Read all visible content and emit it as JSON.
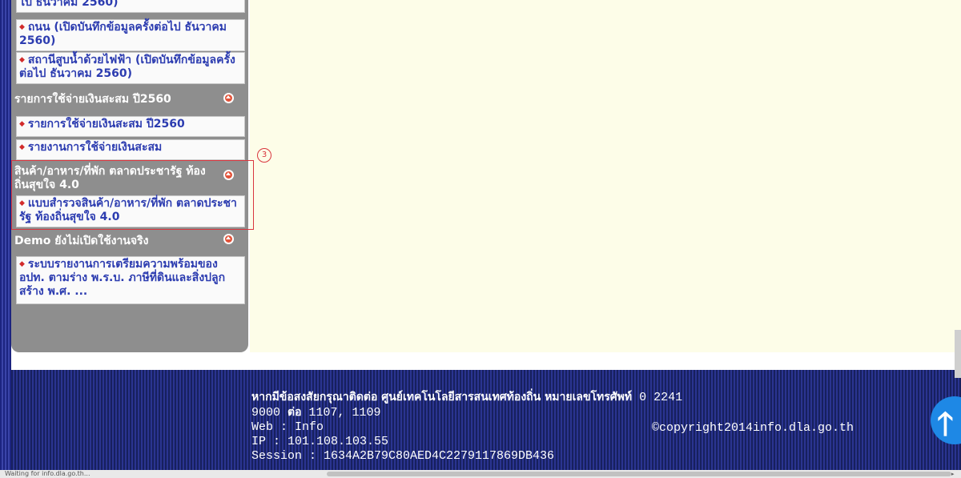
{
  "sidebar": {
    "top_cut_text": "ไป ธันวาคม 2560)",
    "links_group1": [
      "ถนน (เปิดบันทึกข้อมูลครั้งต่อไป ธันวาคม 2560)",
      "สถานีสูบน้ำด้วยไฟฟ้า (เปิดบันทึกข้อมูลครั้งต่อไป ธันวาคม 2560)"
    ],
    "section2": {
      "header": "รายการใช้จ่ายเงินสะสม ปี2560",
      "links": [
        "รายการใช้จ่ายเงินสะสม ปี2560",
        "รายงานการใช้จ่ายเงินสะสม"
      ]
    },
    "section3": {
      "header": "สินค้า/อาหาร/ที่พัก ตลาดประชารัฐ ท้องถิ่นสุขใจ 4.0",
      "links": [
        "แบบสำรวจสินค้า/อาหาร/ที่พัก ตลาดประชารัฐ ท้องถิ่นสุขใจ 4.0"
      ]
    },
    "section4": {
      "header": "Demo ยังไม่เปิดใช้งานจริง",
      "links": [
        "ระบบรายงานการเตรียมความพร้อมของ อปท. ตามร่าง พ.ร.บ. ภาษีที่ดินและสิ่งปลูกสร้าง พ.ศ. ..."
      ]
    },
    "bullet": "◆"
  },
  "annotation": {
    "number": "3"
  },
  "footer": {
    "contact_line1_th": "หากมีข้อสงสัยกรุณาติดต่อ ศูนย์เทคโนโลยีสารสนเทศท้องถิ่น หมายเลขโทรศัพท์",
    "contact_line1_num": " 0 2241",
    "contact_line2_a": "9000 ",
    "contact_line2_th": "ต่อ",
    "contact_line2_b": " 1107, 1109",
    "web": "Web : Info",
    "ip": "IP : 101.108.103.55",
    "session": "Session : 1634A2B79C80AED4C2279117869DB436",
    "copyright": "©copyright2014info.dla.go.th",
    "scroll_top_symbol": "🡑"
  },
  "statusbar": {
    "text": "Waiting for info.dla.go.th..."
  },
  "colors": {
    "link": "#2c3cb0",
    "bullet": "#d22b2b",
    "sidebar_bg": "#8e8e8e",
    "content_bg": "#fdfde8",
    "annotation": "#d9363e",
    "footer_bg": "#1c2480",
    "scroll_top": "#1e88e5"
  }
}
